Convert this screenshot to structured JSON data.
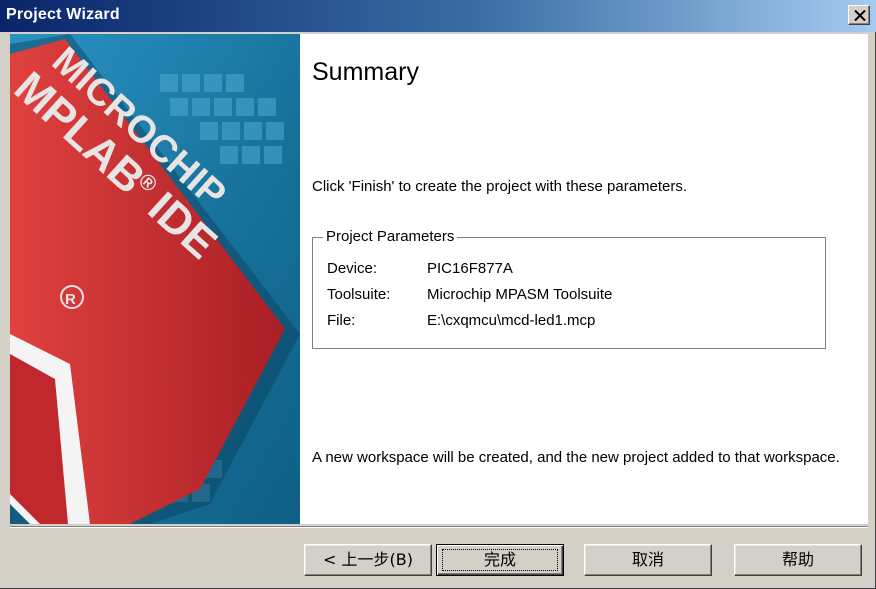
{
  "window": {
    "title": "Project Wizard",
    "close_icon": "close-icon"
  },
  "banner": {
    "brand_line1": "MICROCHIP",
    "brand_line2": "MPLAB",
    "brand_line3": "IDE",
    "registered_mark": "®"
  },
  "summary": {
    "heading": "Summary",
    "intro": "Click 'Finish' to create the project with these parameters.",
    "group_title": "Project Parameters",
    "params": [
      {
        "label": "Device:",
        "value": "PIC16F877A"
      },
      {
        "label": "Toolsuite:",
        "value": "Microchip MPASM Toolsuite"
      },
      {
        "label": "File:",
        "value": "E:\\cxqmcu\\mcd-led1.mcp"
      }
    ],
    "footer": "A new workspace will be created, and the new project added to that workspace."
  },
  "buttons": {
    "back": "< 上一步(B)",
    "finish": "完成",
    "cancel": "取消",
    "help": "帮助"
  },
  "colors": {
    "titlebar_start": "#0a246a",
    "titlebar_end": "#a6caf0",
    "dialog_face": "#d4d0c8",
    "banner_blue": "#1d7fb0",
    "banner_red": "#c0282d"
  }
}
